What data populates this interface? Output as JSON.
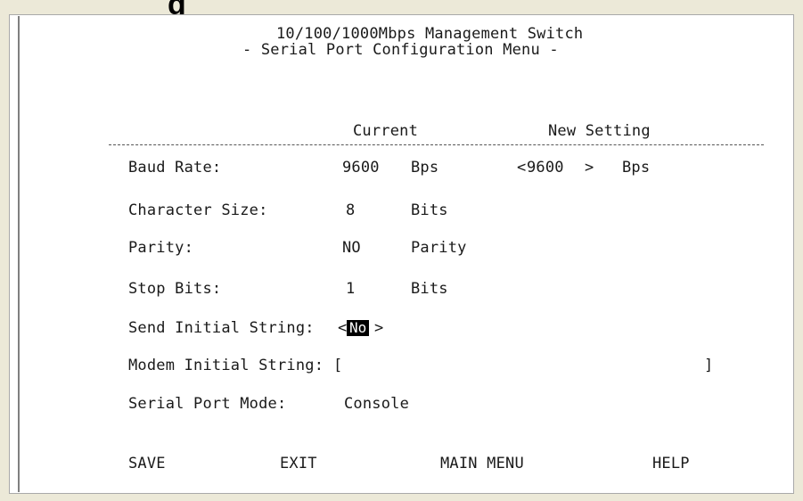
{
  "page_fragment": "g",
  "header": {
    "line1": "10/100/1000Mbps Management Switch",
    "line2": "- Serial Port Configuration Menu -"
  },
  "columns": {
    "current": "Current",
    "new": "New Setting"
  },
  "rows": {
    "baud": {
      "label": "Baud Rate:",
      "value": "9600",
      "unit": "Bps",
      "new_open": "<",
      "new_value": "9600",
      "new_close": ">",
      "new_unit": "Bps"
    },
    "char": {
      "label": "Character Size:",
      "value": "8",
      "unit": "Bits"
    },
    "parity": {
      "label": "Parity:",
      "value": "NO",
      "unit": "Parity"
    },
    "stop": {
      "label": "Stop Bits:",
      "value": "1",
      "unit": "Bits"
    },
    "send": {
      "label": "Send Initial String:",
      "open": "<",
      "value": "No",
      "close": ">"
    },
    "modem": {
      "label": "Modem Initial String:",
      "open": "[",
      "value": "",
      "close": "]"
    },
    "mode": {
      "label": "Serial Port Mode:",
      "value": "Console"
    }
  },
  "actions": {
    "save": "SAVE",
    "exit": "EXIT",
    "main": "MAIN MENU",
    "help": "HELP"
  }
}
